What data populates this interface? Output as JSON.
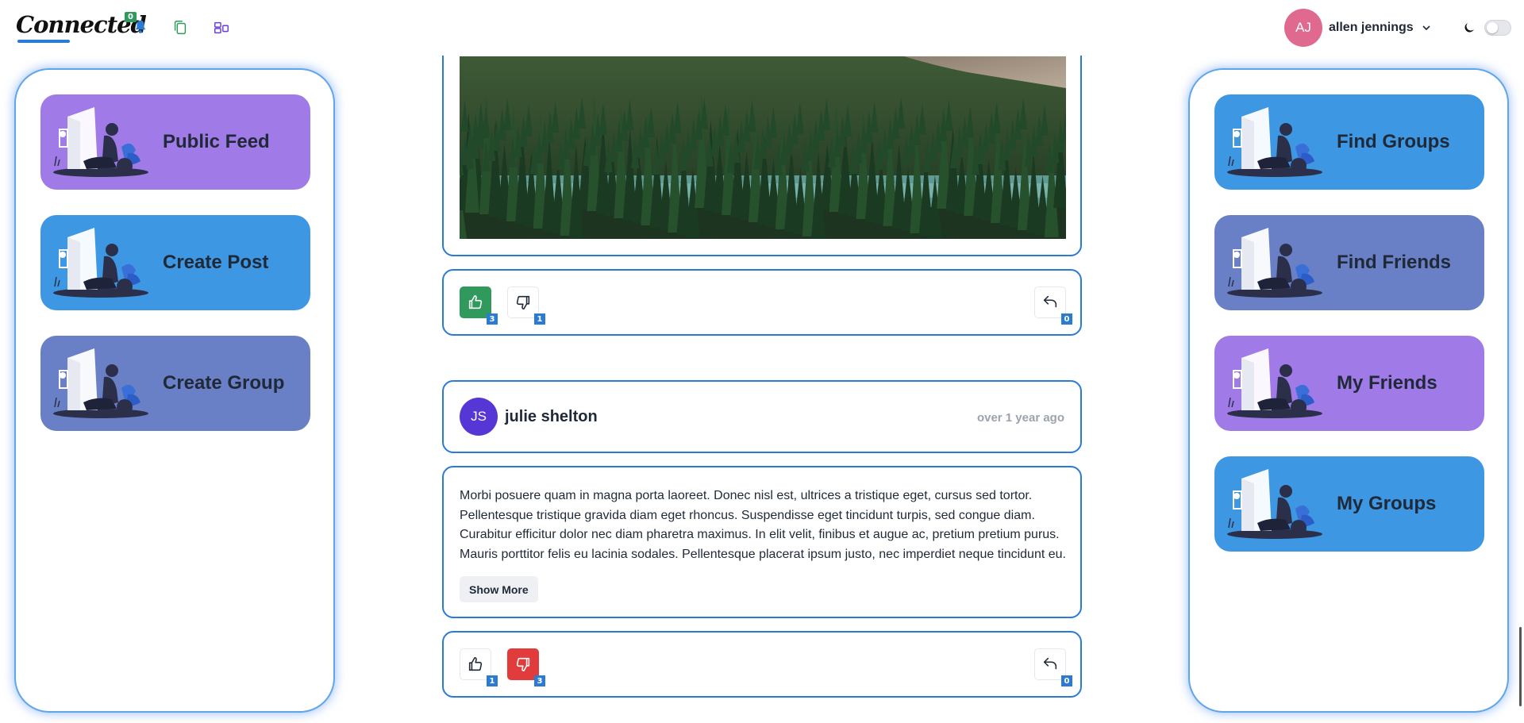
{
  "app": {
    "logo": "Connected"
  },
  "header": {
    "notification_count": "0",
    "user": {
      "initials": "AJ",
      "name": "allen jennings"
    }
  },
  "left_menu": [
    {
      "label": "Public Feed",
      "color": "#a07be8"
    },
    {
      "label": "Create Post",
      "color": "#3d97e2"
    },
    {
      "label": "Create Group",
      "color": "#6a80c6"
    }
  ],
  "right_menu": [
    {
      "label": "Find Groups",
      "color": "#3d97e2"
    },
    {
      "label": "Find Friends",
      "color": "#6a80c6"
    },
    {
      "label": "My Friends",
      "color": "#a07be8"
    },
    {
      "label": "My Groups",
      "color": "#3d97e2"
    }
  ],
  "posts": [
    {
      "likes": "3",
      "dislikes": "1",
      "replies": "0",
      "user_reaction": "like"
    },
    {
      "author": {
        "initials": "JS",
        "name": "julie shelton"
      },
      "time": "over 1 year ago",
      "body": "Morbi posuere quam in magna porta laoreet. Donec nisl est, ultrices a tristique eget, cursus sed tortor. Pellentesque tristique gravida diam eget rhoncus. Suspendisse eget tincidunt turpis, sed congue diam. Curabitur efficitur dolor nec diam pharetra maximus. In elit velit, finibus et augue ac, pretium pretium purus. Mauris porttitor felis eu lacinia sodales. Pellentesque placerat ipsum justo, nec imperdiet neque tincidunt eu.",
      "show_more_label": "Show More",
      "likes": "1",
      "dislikes": "3",
      "replies": "0",
      "user_reaction": "dislike"
    }
  ],
  "colors": {
    "accent": "#2b7bd4",
    "like": "#2f9a5b",
    "dislike": "#e23b3b"
  }
}
